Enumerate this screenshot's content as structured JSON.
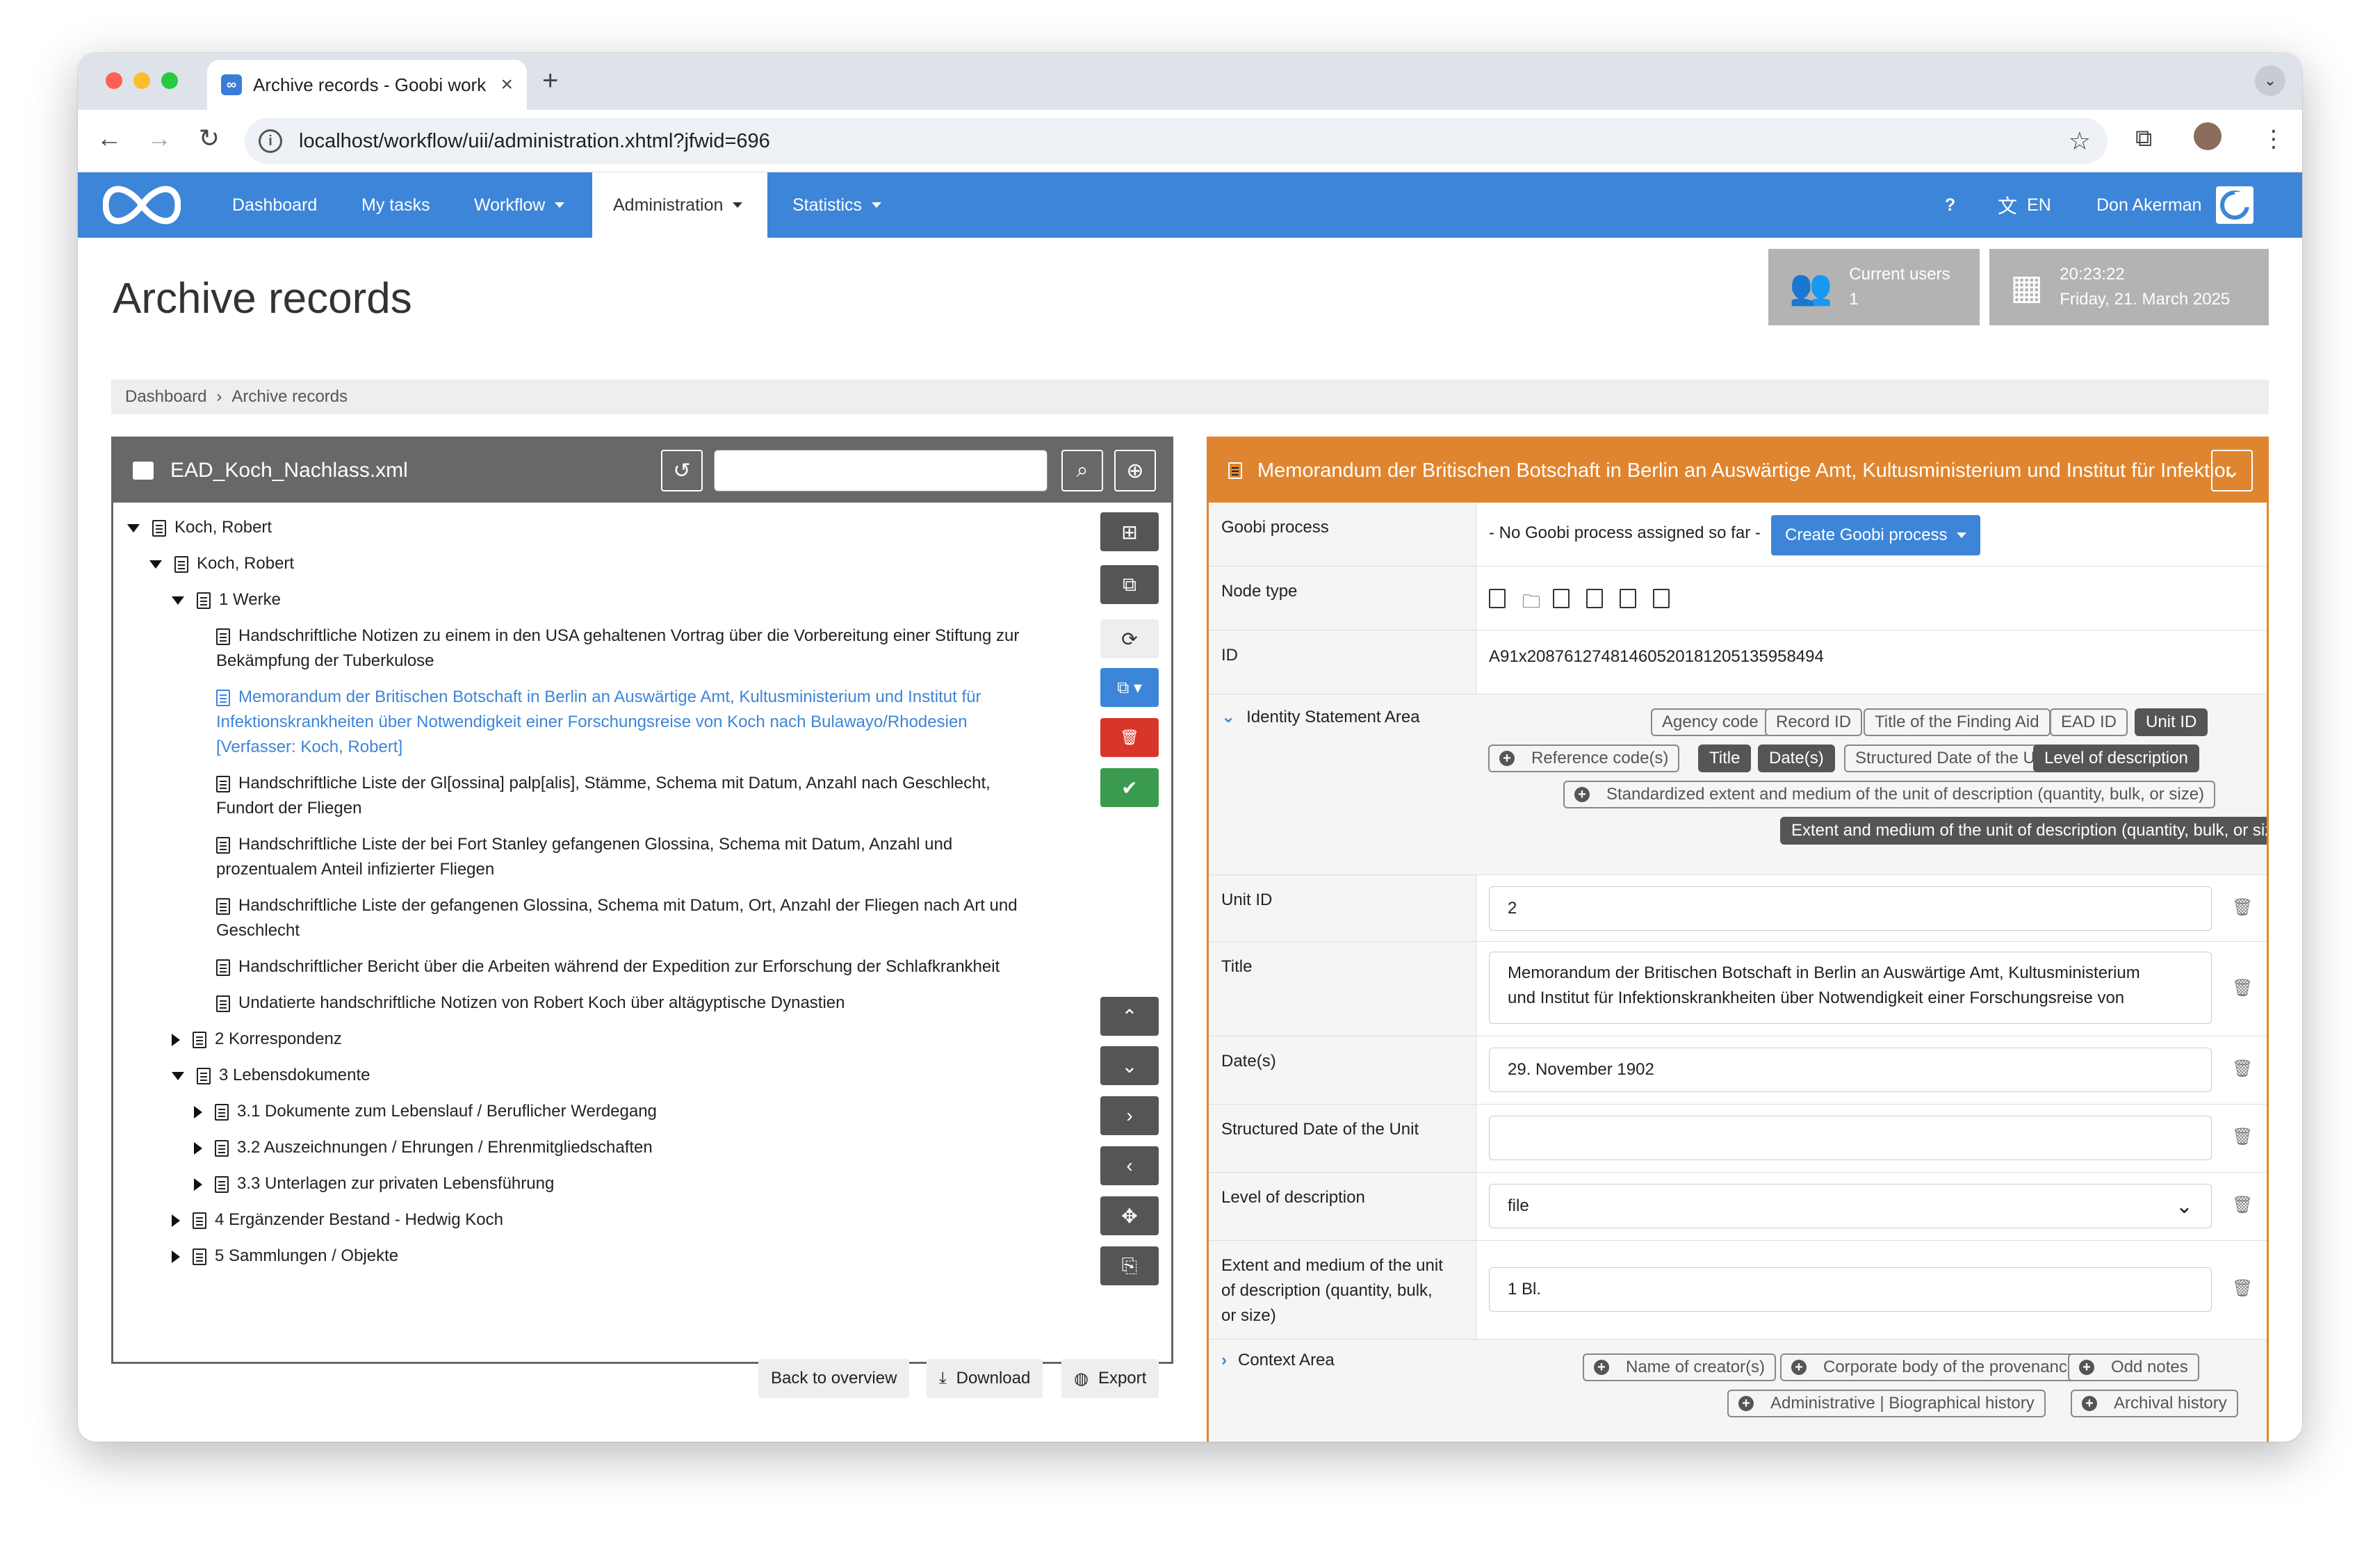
{
  "browser": {
    "tab_title": "Archive records - Goobi work",
    "url": "localhost/workflow/uii/administration.xhtml?jfwid=696"
  },
  "nav": {
    "items": [
      "Dashboard",
      "My tasks",
      "Workflow",
      "Administration",
      "Statistics"
    ],
    "help": "?",
    "language": "EN",
    "user": "Don Akerman"
  },
  "page": {
    "title": "Archive records",
    "widgets": {
      "users_label": "Current users",
      "users_count": "1",
      "time": "20:23:22",
      "date": "Friday, 21. March 2025"
    },
    "breadcrumb": [
      "Dashboard",
      "Archive records"
    ]
  },
  "tree_panel": {
    "filename": "EAD_Koch_Nachlass.xml",
    "search_placeholder": "",
    "nodes": [
      "Koch, Robert",
      "Koch, Robert",
      "1 Werke",
      "Handschriftliche Notizen zu einem in den USA gehaltenen Vortrag über die Vorbereitung einer Stiftung zur",
      "Bekämpfung der Tuberkulose",
      "Memorandum der Britischen Botschaft in Berlin an Auswärtige Amt, Kultusministerium und Institut für",
      "Infektionskrankheiten über Notwendigkeit einer Forschungsreise von Koch nach Bulawayo/Rhodesien",
      "[Verfasser: Koch, Robert]",
      "Handschriftliche Liste der Gl[ossina] palp[alis], Stämme, Schema mit Datum, Anzahl nach Geschlecht,",
      "Fundort der Fliegen",
      "Handschriftliche Liste der bei Fort Stanley gefangenen Glossina, Schema mit Datum, Anzahl und",
      "prozentualem Anteil infizierter Fliegen",
      "Handschriftliche Liste der gefangenen Glossina, Schema mit Datum, Ort, Anzahl der Fliegen nach Art und",
      "Geschlecht",
      "Handschriftlicher Bericht über die Arbeiten während der Expedition zur Erforschung der Schlafkrankheit",
      "Undatierte handschriftliche Notizen von Robert Koch über altägyptische Dynastien",
      "2 Korrespondenz",
      "3 Lebensdokumente",
      "3.1 Dokumente zum Lebenslauf / Beruflicher Werdegang",
      "3.2 Auszeichnungen / Ehrungen / Ehrenmitgliedschaften",
      "3.3 Unterlagen zur privaten Lebensführung",
      "4 Ergänzender Bestand - Hedwig Koch",
      "5 Sammlungen / Objekte"
    ],
    "buttons": {
      "back": "Back to overview",
      "download": "Download",
      "export": "Export"
    }
  },
  "detail_panel": {
    "title": "Memorandum der Britischen Botschaft in Berlin an Auswärtige Amt, Kultusministerium und Institut für Infektionskrankheiten",
    "goobi_label": "Goobi process",
    "goobi_text": "- No Goobi process assigned so far -",
    "goobi_button": "Create Goobi process",
    "node_type_label": "Node type",
    "id_label": "ID",
    "id_value": "A91x20876127481460520181205135958494",
    "identity_section": "Identity Statement Area",
    "identity_badges": [
      "Agency code",
      "Record ID",
      "Title of the Finding Aid",
      "EAD ID",
      "Unit ID",
      "Reference code(s)",
      "Title",
      "Date(s)",
      "Structured Date of the Unit",
      "Level of description",
      "Standardized extent and medium of the unit of description (quantity, bulk, or size)",
      "Extent and medium of the unit of description (quantity, bulk, or size)"
    ],
    "fields": {
      "unit_id_label": "Unit ID",
      "unit_id_value": "2",
      "title_label": "Title",
      "title_value_1": "Memorandum der Britischen Botschaft in Berlin an Auswärtige Amt, Kultusministerium",
      "title_value_2": "und Institut für Infektionskrankheiten über Notwendigkeit einer Forschungsreise von",
      "dates_label": "Date(s)",
      "dates_value": "29. November 1902",
      "structured_label": "Structured Date of the Unit",
      "structured_value": "",
      "level_label": "Level of description",
      "level_value": "file",
      "extent_label_1": "Extent and medium of the unit",
      "extent_label_2": "of description (quantity, bulk,",
      "extent_label_3": "or size)",
      "extent_value": "1 Bl."
    },
    "context_section": "Context Area",
    "context_badges": [
      "Name of creator(s)",
      "Corporate body of the provenance",
      "Odd notes",
      "Administrative | Biographical history",
      "Archival history"
    ]
  },
  "colors": {
    "nav_blue": "#3d85d8",
    "orange": "#e0852f",
    "red": "#d9362b",
    "green": "#3a9b4f"
  }
}
